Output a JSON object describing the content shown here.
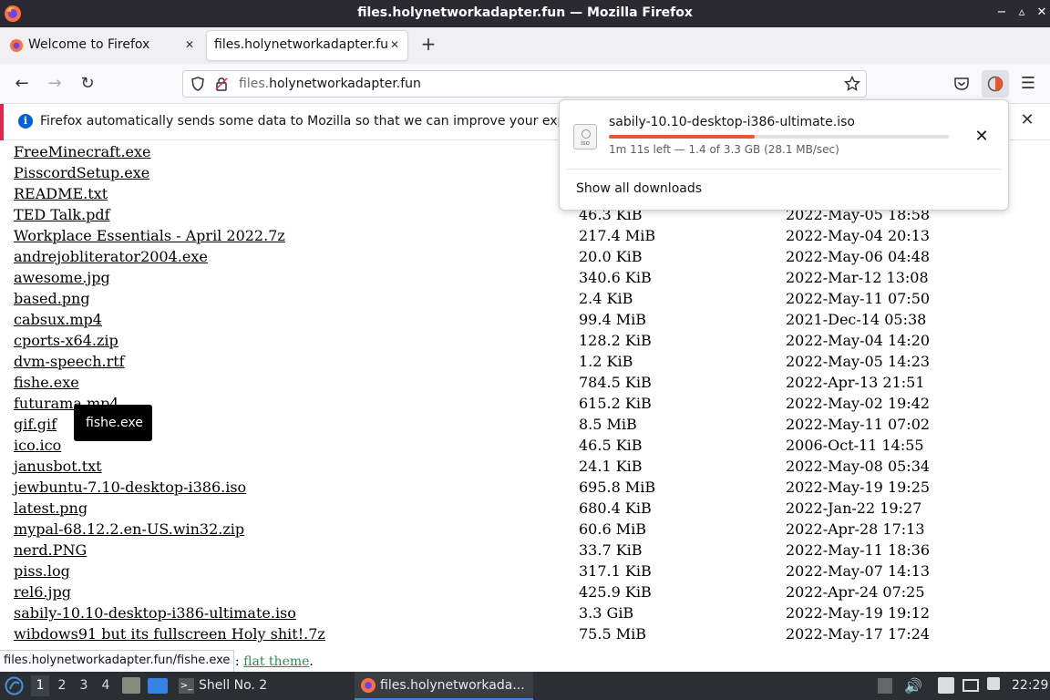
{
  "window": {
    "title": "files.holynetworkadapter.fun — Mozilla Firefox"
  },
  "tabs": [
    {
      "label": "Welcome to Firefox",
      "active": false
    },
    {
      "label": "files.holynetworkadapter.fun",
      "active": true
    }
  ],
  "urlbar": {
    "url_prefix": "files.",
    "url_domain": "holynetworkadapter.fun"
  },
  "notification": {
    "message": "Firefox automatically sends some data to Mozilla so that we can improve your experience."
  },
  "downloads": {
    "filename": "sabily-10.10-desktop-i386-ultimate.iso",
    "file_type": "iso",
    "status": "1m 11s left — 1.4 of 3.3 GB (28.1 MB/sec)",
    "progress_fraction": 0.43,
    "show_all_label": "Show all downloads"
  },
  "files": [
    {
      "name": "FreeMinecraft.exe",
      "size": "",
      "date": ""
    },
    {
      "name": "PisscordSetup.exe",
      "size": "",
      "date": ""
    },
    {
      "name": "README.txt",
      "size": "",
      "date": ""
    },
    {
      "name": "TED Talk.pdf",
      "size": "46.3 KiB",
      "date": "2022-May-05 18:58"
    },
    {
      "name": "Workplace Essentials - April 2022.7z",
      "size": "217.4 MiB",
      "date": "2022-May-04 20:13"
    },
    {
      "name": "andrejobliterator2004.exe",
      "size": "20.0 KiB",
      "date": "2022-May-06 04:48"
    },
    {
      "name": "awesome.jpg",
      "size": "340.6 KiB",
      "date": "2022-Mar-12 13:08"
    },
    {
      "name": "based.png",
      "size": "2.4 KiB",
      "date": "2022-May-11 07:50"
    },
    {
      "name": "cabsux.mp4",
      "size": "99.4 MiB",
      "date": "2021-Dec-14 05:38"
    },
    {
      "name": "cports-x64.zip",
      "size": "128.2 KiB",
      "date": "2022-May-04 14:20"
    },
    {
      "name": "dvm-speech.rtf",
      "size": "1.2 KiB",
      "date": "2022-May-05 14:23"
    },
    {
      "name": "fishe.exe",
      "size": "784.5 KiB",
      "date": "2022-Apr-13 21:51"
    },
    {
      "name": "futurama.mp4",
      "size": "615.2 KiB",
      "date": "2022-May-02 19:42"
    },
    {
      "name": "gif.gif",
      "size": "8.5 MiB",
      "date": "2022-May-11 07:02"
    },
    {
      "name": "ico.ico",
      "size": "46.5 KiB",
      "date": "2006-Oct-11 14:55"
    },
    {
      "name": "janusbot.txt",
      "size": "24.1 KiB",
      "date": "2022-May-08 05:34"
    },
    {
      "name": "jewbuntu-7.10-desktop-i386.iso",
      "size": "695.8 MiB",
      "date": "2022-May-19 19:25"
    },
    {
      "name": "latest.png",
      "size": "680.4 KiB",
      "date": "2022-Jan-22 19:27"
    },
    {
      "name": "mypal-68.12.2.en-US.win32.zip",
      "size": "60.6 MiB",
      "date": "2022-Apr-28 17:13"
    },
    {
      "name": "nerd.PNG",
      "size": "33.7 KiB",
      "date": "2022-May-11 18:36"
    },
    {
      "name": "piss.log",
      "size": "317.1 KiB",
      "date": "2022-May-07 14:13"
    },
    {
      "name": "rel6.jpg",
      "size": "425.9 KiB",
      "date": "2022-Apr-24 07:25"
    },
    {
      "name": "sabily-10.10-desktop-i386-ultimate.iso",
      "size": "3.3 GiB",
      "date": "2022-May-19 19:12"
    },
    {
      "name": "wibdows91 but its fullscreen Holy shit!.7z",
      "size": "75.5 MiB",
      "date": "2022-May-17 17:24"
    }
  ],
  "footer": {
    "prefix": ": ",
    "link": "flat theme",
    "suffix": "."
  },
  "tooltip": {
    "text": "fishe.exe"
  },
  "status_link": "files.holynetworkadapter.fun/fishe.exe",
  "taskbar": {
    "workspaces": [
      "1",
      "2",
      "3",
      "4"
    ],
    "shell_task": "Shell No. 2",
    "firefox_task": "files.holynetworkada...",
    "clock": "22:29"
  },
  "colors": {
    "accent": "#e35a2b",
    "notif_stripe": "#e22850",
    "info_blue": "#0060df"
  }
}
